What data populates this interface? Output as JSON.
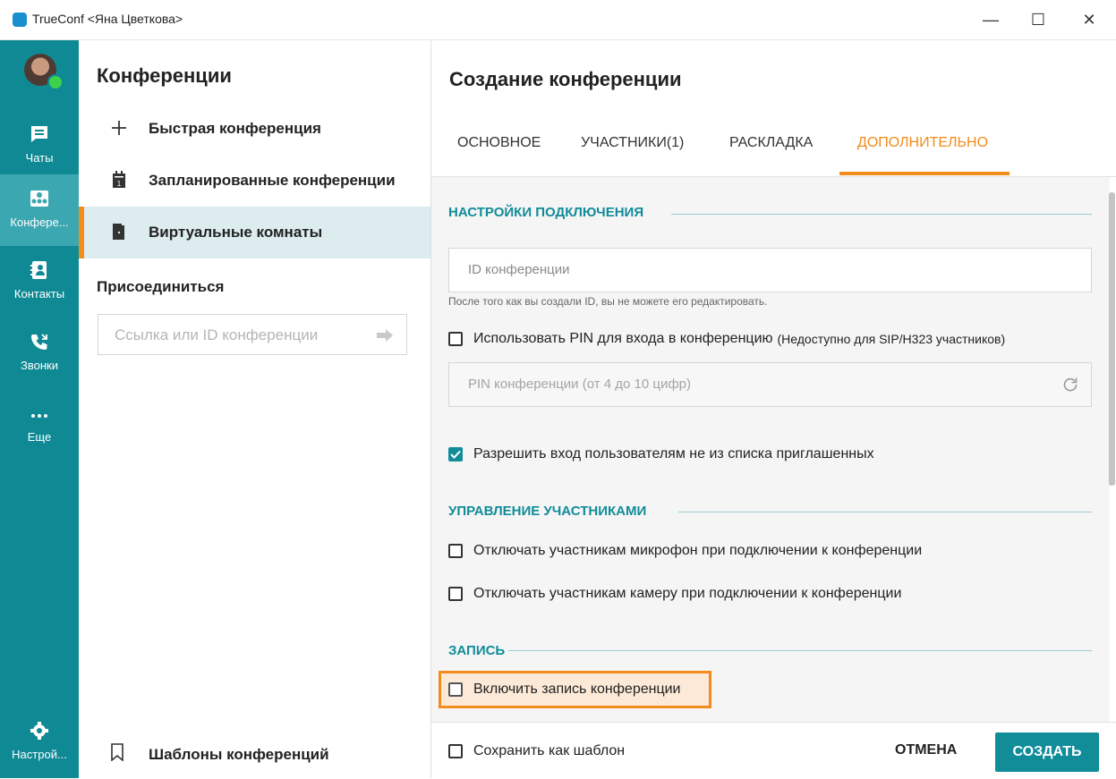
{
  "window": {
    "title": "TrueConf <Яна Цветкова>",
    "minimize_glyph": "—",
    "maximize_glyph": "☐",
    "close_glyph": "✕"
  },
  "rail": {
    "items": [
      {
        "label": "Чаты",
        "icon": "chat-icon"
      },
      {
        "label": "Конфере...",
        "icon": "conference-icon",
        "active": true
      },
      {
        "label": "Контакты",
        "icon": "contacts-icon"
      },
      {
        "label": "Звонки",
        "icon": "calls-icon"
      },
      {
        "label": "Еще",
        "icon": "more-icon"
      }
    ],
    "settings_label": "Настрой..."
  },
  "conferences": {
    "title": "Конференции",
    "items": [
      {
        "label": "Быстрая конференция",
        "icon": "plus-icon"
      },
      {
        "label": "Запланированные конференции",
        "icon": "calendar-icon"
      },
      {
        "label": "Виртуальные комнаты",
        "icon": "door-icon",
        "active": true
      }
    ],
    "join_title": "Присоединиться",
    "join_placeholder": "Ссылка или ID конференции",
    "templates_label": "Шаблоны конференций"
  },
  "create": {
    "title": "Создание конференции",
    "tabs": [
      {
        "label": "ОСНОВНОЕ"
      },
      {
        "label": "УЧАСТНИКИ(1)"
      },
      {
        "label": "РАСКЛАДКА"
      },
      {
        "label": "ДОПОЛНИТЕЛЬНО",
        "active": true
      }
    ],
    "connection": {
      "heading": "НАСТРОЙКИ ПОДКЛЮЧЕНИЯ",
      "id_placeholder": "ID конференции",
      "id_hint": "После того как вы создали ID, вы не можете его редактировать.",
      "use_pin_label": "Использовать PIN для входа в конференцию",
      "use_pin_note": "(Недоступно для SIP/H323 участников)",
      "use_pin_checked": false,
      "pin_placeholder": "PIN конференции (от 4 до 10 цифр)",
      "allow_uninvited_label": "Разрешить вход пользователям не из списка приглашенных",
      "allow_uninvited_checked": true
    },
    "participants": {
      "heading": "УПРАВЛЕНИЕ УЧАСТНИКАМИ",
      "mute_mic_label": "Отключать участникам микрофон при подключении к конференции",
      "mute_mic_checked": false,
      "mute_cam_label": "Отключать участникам камеру при подключении к конференции",
      "mute_cam_checked": false
    },
    "recording": {
      "heading": "ЗАПИСЬ",
      "enable_label": "Включить запись конференции",
      "enable_checked": false
    },
    "footer": {
      "save_template_label": "Сохранить как шаблон",
      "cancel_label": "ОТМЕНА",
      "create_label": "СОЗДАТЬ"
    }
  },
  "colors": {
    "rail": "#0f8a95",
    "accent": "#f28c1c",
    "primary": "#118c99"
  }
}
